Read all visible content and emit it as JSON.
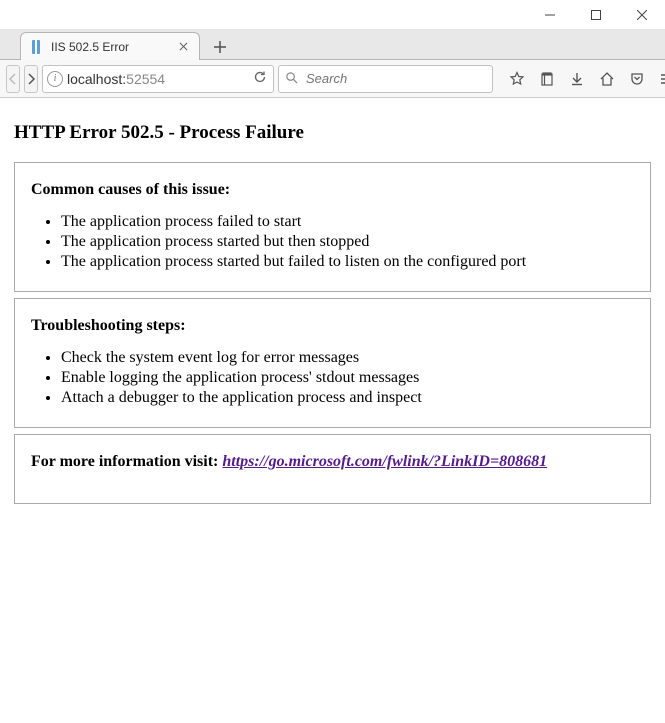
{
  "window": {
    "tab_title": "IIS 502.5 Error",
    "url_host": "localhost:",
    "url_port": "52554"
  },
  "search": {
    "placeholder": "Search"
  },
  "page": {
    "title": "HTTP Error 502.5 - Process Failure",
    "causes_heading": "Common causes of this issue:",
    "causes": [
      "The application process failed to start",
      "The application process started but then stopped",
      "The application process started but failed to listen on the configured port"
    ],
    "trouble_heading": "Troubleshooting steps:",
    "trouble": [
      "Check the system event log for error messages",
      "Enable logging the application process' stdout messages",
      "Attach a debugger to the application process and inspect"
    ],
    "more_label": "For more information visit: ",
    "more_link": "https://go.microsoft.com/fwlink/?LinkID=808681"
  }
}
